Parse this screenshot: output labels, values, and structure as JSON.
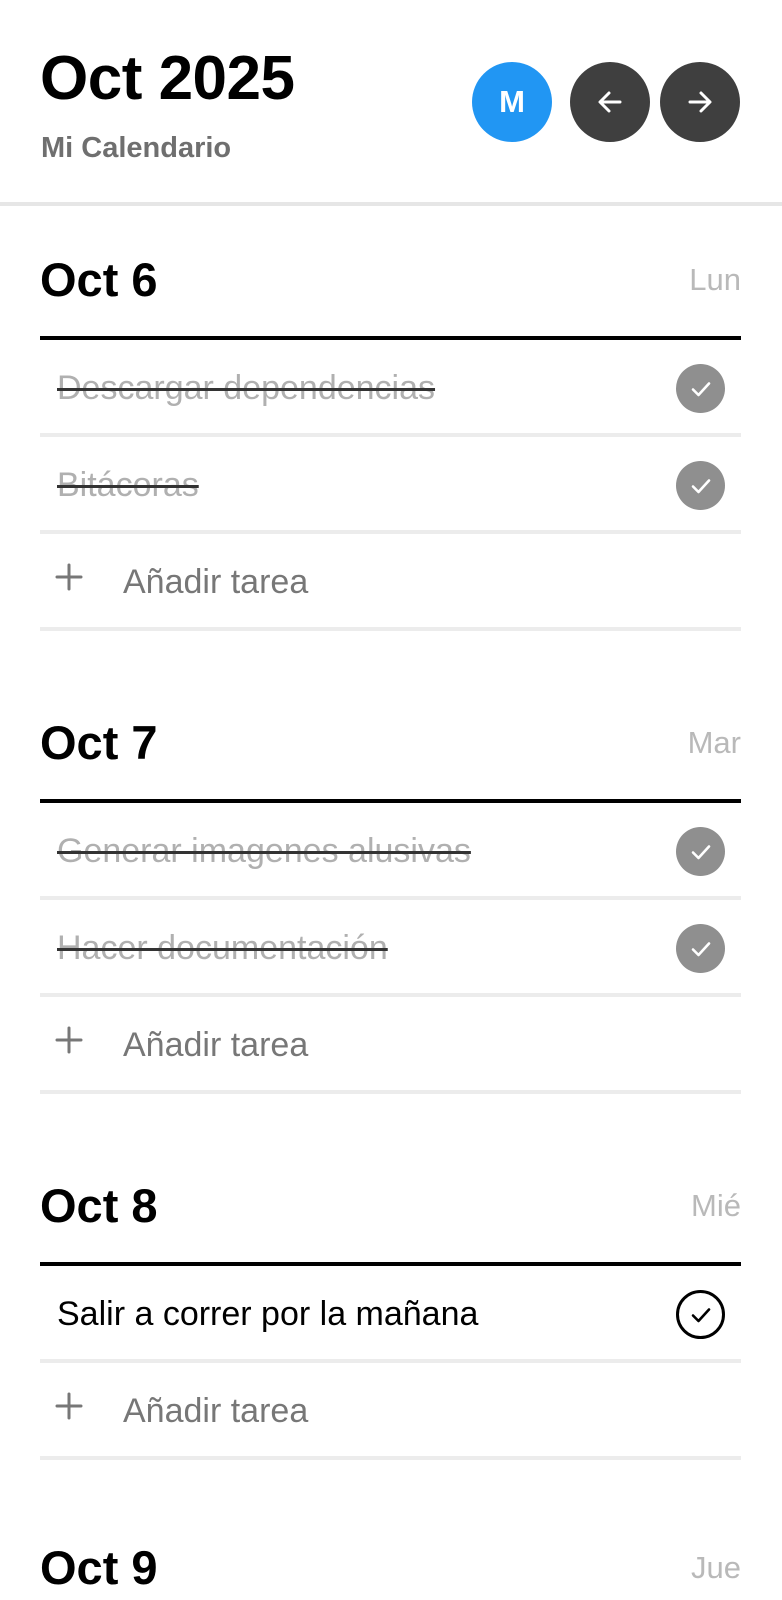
{
  "header": {
    "month_title": "Oct 2025",
    "subtitle": "Mi Calendario",
    "avatar_initial": "M",
    "avatar_color": "#2196f3",
    "nav_button_color": "#3f3f3f",
    "prev_icon": "arrow-left-icon",
    "next_icon": "arrow-right-icon"
  },
  "add_task_label": "Añadir tarea",
  "days": [
    {
      "date": "Oct 6",
      "weekday": "Lun",
      "tasks": [
        {
          "text": "Descargar dependencias",
          "done": true
        },
        {
          "text": "Bitácoras",
          "done": true
        }
      ]
    },
    {
      "date": "Oct 7",
      "weekday": "Mar",
      "tasks": [
        {
          "text": "Generar imagenes alusivas",
          "done": true
        },
        {
          "text": "Hacer documentación",
          "done": true
        }
      ]
    },
    {
      "date": "Oct 8",
      "weekday": "Mié",
      "tasks": [
        {
          "text": "Salir a correr por la mañana",
          "done": false
        }
      ]
    },
    {
      "date": "Oct 9",
      "weekday": "Jue",
      "tasks": []
    }
  ]
}
